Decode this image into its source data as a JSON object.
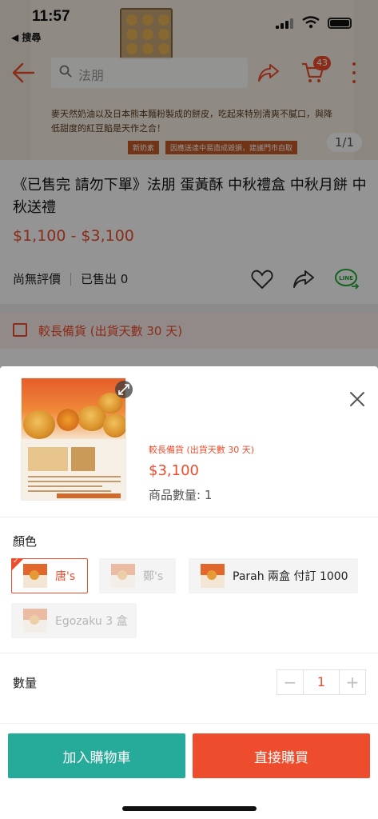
{
  "status_bar": {
    "time": "11:57",
    "back_app": "◀ 搜尋"
  },
  "nav": {
    "search_placeholder": "法朋",
    "cart_count": "43",
    "accent": "#ee4d2d"
  },
  "hero": {
    "promo_text": "麥天然奶油以及日本熊本麵粉製成的餅皮，吃起來特別清爽不膩口，與降低甜度的紅豆餡是天作之合！",
    "tag1": "新奶素",
    "tag2": "因應送達中易造成毀損，建議門市自取",
    "counter": "1/1"
  },
  "product": {
    "title": "《已售完 請勿下單》法朋 蛋黃酥 中秋禮盒 中秋月餅 中秋送禮",
    "price_range": "$1,100 - $3,100",
    "no_rating": "尚無評價",
    "sold": "已售出 0",
    "prep_notice": "較長備貨 (出貨天數 30 天)"
  },
  "sheet": {
    "prep_notice": "較長備貨 (出貨天數 30 天)",
    "price": "$3,100",
    "stock_label": "商品數量: 1",
    "color_label": "顏色",
    "options": [
      {
        "label": "唐's",
        "state": "selected"
      },
      {
        "label": "鄭's",
        "state": "disabled"
      },
      {
        "label": "Parah 兩盒 付訂 1000",
        "state": "normal"
      },
      {
        "label": "Egozaku 3 盒",
        "state": "disabled"
      }
    ],
    "qty_label": "數量",
    "qty_value": "1",
    "qty_minus": "−",
    "qty_plus": "+",
    "add_to_cart": "加入購物車",
    "buy_now": "直接購買",
    "cart_color": "#26aa99"
  }
}
